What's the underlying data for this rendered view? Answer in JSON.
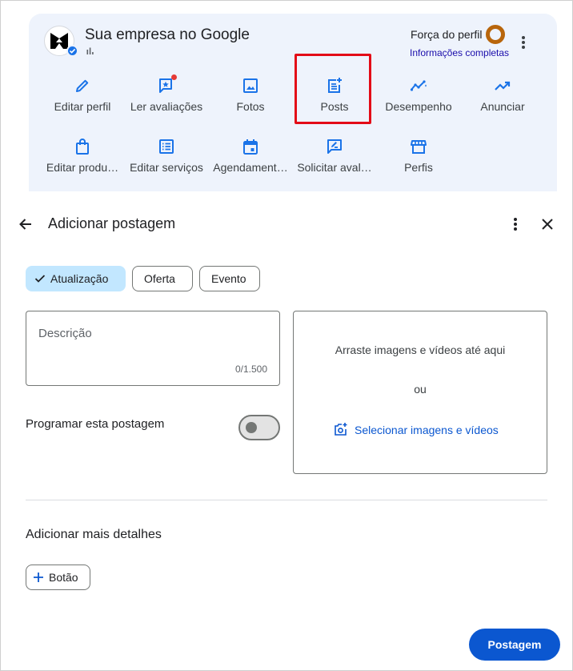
{
  "business": {
    "name": "Sua empresa no Google",
    "strength_label": "Força do perfil",
    "strength_link": "Informações completas",
    "strength_level": 1.0
  },
  "actions_row1": [
    {
      "label": "Editar perfil",
      "icon": "pencil-icon"
    },
    {
      "label": "Ler avaliações",
      "icon": "review-star-icon"
    },
    {
      "label": "Fotos",
      "icon": "photo-icon"
    },
    {
      "label": "Posts",
      "icon": "post-add-icon"
    },
    {
      "label": "Desempenho",
      "icon": "performance-icon"
    },
    {
      "label": "Anunciar",
      "icon": "trending-up-icon"
    }
  ],
  "actions_row2": [
    {
      "label": "Editar produ…",
      "icon": "shopping-bag-icon"
    },
    {
      "label": "Editar serviços",
      "icon": "list-icon"
    },
    {
      "label": "Agendament…",
      "icon": "calendar-icon"
    },
    {
      "label": "Solicitar aval…",
      "icon": "request-review-icon"
    },
    {
      "label": "Perfis",
      "icon": "storefront-icon"
    }
  ],
  "form": {
    "title": "Adicionar postagem",
    "chips": [
      "Atualização",
      "Oferta",
      "Evento"
    ],
    "selected_chip": "Atualização",
    "description_placeholder": "Descrição",
    "char_count": "0/1.500",
    "schedule_label": "Programar esta postagem",
    "schedule_enabled": false,
    "drop_text": "Arraste imagens e vídeos até aqui",
    "drop_or": "ou",
    "select_media": "Selecionar imagens e vídeos",
    "more_details": "Adicionar mais detalhes",
    "add_button": "Botão",
    "submit": "Postagem"
  },
  "colors": {
    "panel_bg": "#eef3fc",
    "accent": "#0b57d0",
    "chip_selected": "#c2e7ff",
    "highlight": "#e30b17",
    "ring_color": "#b8650b"
  }
}
